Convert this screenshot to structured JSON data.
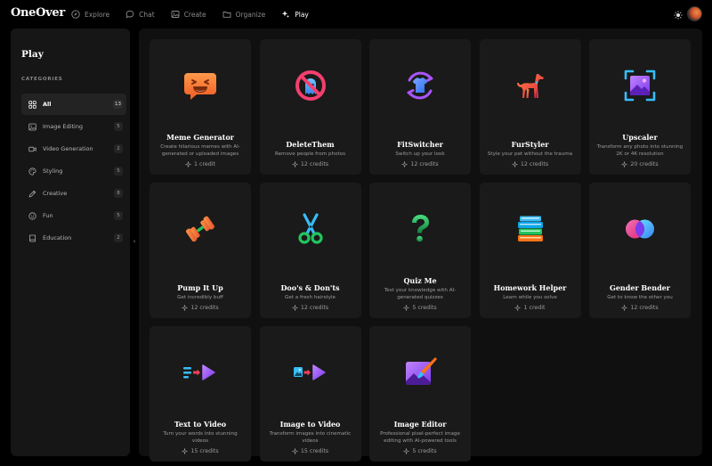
{
  "app": {
    "logo": "OneOver"
  },
  "nav": [
    {
      "label": "Explore",
      "icon": "compass-icon",
      "active": false
    },
    {
      "label": "Chat",
      "icon": "chat-bubble-icon",
      "active": false
    },
    {
      "label": "Create",
      "icon": "image-icon",
      "active": false
    },
    {
      "label": "Organize",
      "icon": "folder-icon",
      "active": false
    },
    {
      "label": "Play",
      "icon": "sparkles-icon",
      "active": true
    }
  ],
  "sidebar": {
    "title": "Play",
    "categories_label": "CATEGORIES",
    "items": [
      {
        "label": "All",
        "count": "13",
        "icon": "grid-icon",
        "active": true
      },
      {
        "label": "Image Editing",
        "count": "5",
        "icon": "image-icon",
        "active": false
      },
      {
        "label": "Video Generation",
        "count": "2",
        "icon": "video-camera-icon",
        "active": false
      },
      {
        "label": "Styling",
        "count": "5",
        "icon": "palette-icon",
        "active": false
      },
      {
        "label": "Creative",
        "count": "8",
        "icon": "pen-icon",
        "active": false
      },
      {
        "label": "Fun",
        "count": "5",
        "icon": "smiley-icon",
        "active": false
      },
      {
        "label": "Education",
        "count": "2",
        "icon": "book-icon",
        "active": false
      }
    ]
  },
  "collapse_glyph": "‹",
  "cards": [
    {
      "title": "Meme Generator",
      "desc": "Create hilarious memes with AI-generated or uploaded images",
      "credits": "1 credit",
      "icon": "laughing-chat-icon"
    },
    {
      "title": "DeleteThem",
      "desc": "Remove people from photos",
      "credits": "12 credits",
      "icon": "ghost-prohibited-icon"
    },
    {
      "title": "FitSwitcher",
      "desc": "Switch up your look",
      "credits": "12 credits",
      "icon": "shirt-swap-icon"
    },
    {
      "title": "FurStyler",
      "desc": "Style your pet without the trauma",
      "credits": "12 credits",
      "icon": "dog-icon"
    },
    {
      "title": "Upscaler",
      "desc": "Transform any photo into stunning 2K or 4K resolution",
      "credits": "20 credits",
      "icon": "upscale-frame-icon"
    },
    {
      "title": "Pump It Up",
      "desc": "Get incredibly buff",
      "credits": "12 credits",
      "icon": "dumbbell-icon"
    },
    {
      "title": "Doo's & Don'ts",
      "desc": "Get a fresh hairstyle",
      "credits": "12 credits",
      "icon": "scissors-icon"
    },
    {
      "title": "Quiz Me",
      "desc": "Test your knowledge with AI-generated quizzes",
      "credits": "5 credits",
      "icon": "question-mark-icon"
    },
    {
      "title": "Homework Helper",
      "desc": "Learn while you solve",
      "credits": "1 credit",
      "icon": "books-stack-icon"
    },
    {
      "title": "Gender Bender",
      "desc": "Get to know the other you",
      "credits": "12 credits",
      "icon": "overlapping-circles-icon"
    },
    {
      "title": "Text to Video",
      "desc": "Turn your words into stunning videos",
      "credits": "15 credits",
      "icon": "text-to-video-icon"
    },
    {
      "title": "Image to Video",
      "desc": "Transform images into cinematic videos",
      "credits": "15 credits",
      "icon": "image-to-video-icon"
    },
    {
      "title": "Image Editor",
      "desc": "Professional pixel-perfect image editing with AI-powered tools",
      "credits": "5 credits",
      "icon": "image-brush-icon"
    }
  ],
  "colors": {
    "accent_orange": "#f07a3a",
    "accent_purple": "#9b5cf6",
    "accent_blue": "#3fa9f5",
    "accent_green": "#22c55e",
    "accent_pink": "#ec4899"
  }
}
